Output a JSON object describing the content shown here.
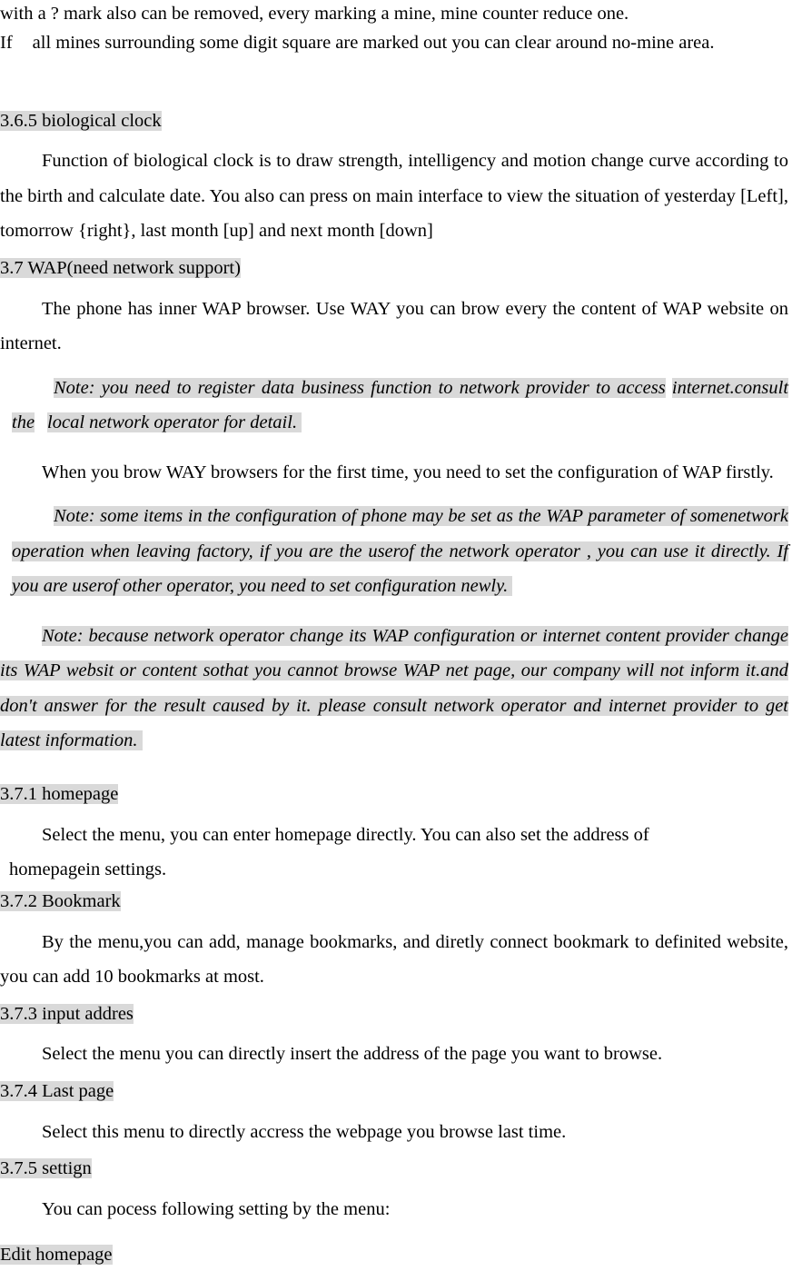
{
  "document": {
    "intro_lines": [
      "with a ? mark also can be removed, every marking a mine, mine counter reduce one.",
      "If",
      "all mines surrounding some digit square are marked out you can clear around no-mine area."
    ],
    "sections": [
      {
        "id": "3.6.5",
        "heading": "3.6.5 biological clock",
        "body": "Function of biological clock is to draw strength, intelligency and motion change curve according to the birth and calculate date. You also can press on main interface to view the situation of yesterday [Left], tomorrow {right}, last month [up] and next month [down]"
      },
      {
        "id": "3.7",
        "heading": "3.7 WAP(need network support)",
        "body_1": "The phone has inner WAP browser. Use WAY you can brow every the content of WAP website on internet.",
        "note_1_a": "Note: you need to register data business function to network provider to access",
        "note_1_b": "internet.consult the",
        "note_1_c": "local network operator for detail.",
        "body_2": "When you brow WAY browsers for the first time, you need to set the configuration of WAP firstly.",
        "note_2": "Note: some items in the configuration of phone may be set as the WAP parameter of somenetwork operation when leaving factory, if you are the userof the network operator , you can use it directly. If you are userof other operator, you need to set   configuration newly.",
        "note_3": "Note: because network operator change its WAP configuration or internet content provider change its WAP websit or content sothat you cannot browse WAP net page, our company will not inform it.and don't answer for the result caused by it. please consult network operator and internet provider to get latest information."
      },
      {
        "id": "3.7.1",
        "heading": "3.7.1 homepage",
        "body_line_1": "Select the menu, you can enter homepage directly. You can also set the address of",
        "body_line_2": "homepagein settings."
      },
      {
        "id": "3.7.2",
        "heading": "3.7.2 Bookmark",
        "body": "By the menu,you can add, manage bookmarks, and diretly connect bookmark to definited website, you can add 10 bookmarks at most."
      },
      {
        "id": "3.7.3",
        "heading": "3.7.3 input addres",
        "body": "Select the menu you can directly insert the address of the page you want to browse."
      },
      {
        "id": "3.7.4",
        "heading": "3.7.4 Last page",
        "body": "Select this menu to directly accress the webpage you browse last time."
      },
      {
        "id": "3.7.5",
        "heading": "3.7.5 settign",
        "body": "You can pocess following setting by the menu:",
        "subheading": "Edit homepage"
      }
    ],
    "colors": {
      "highlight": "#d9d9d9",
      "text": "#000000",
      "page_background": "#ffffff"
    }
  }
}
